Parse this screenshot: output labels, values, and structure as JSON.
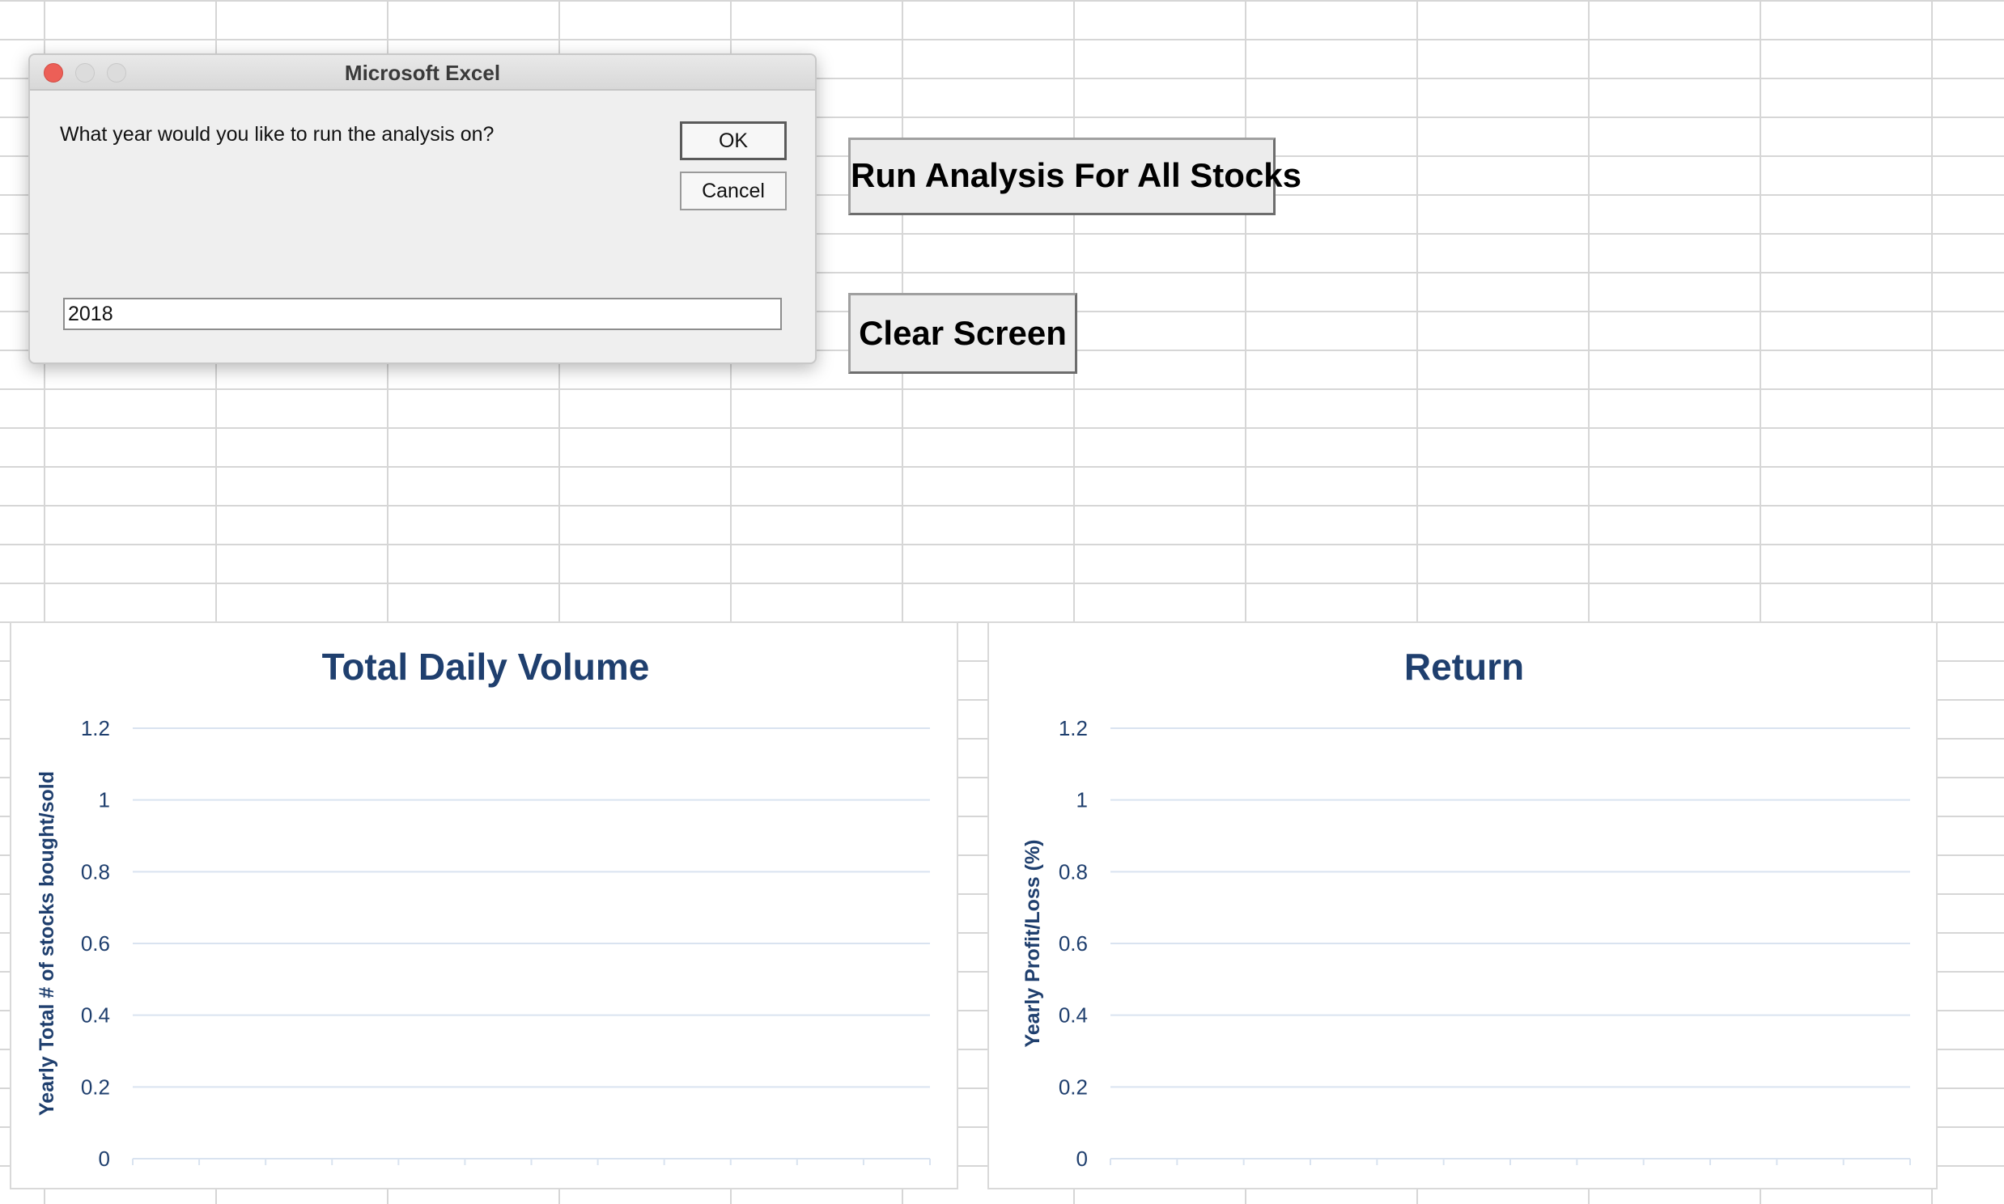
{
  "dialog": {
    "title": "Microsoft Excel",
    "prompt": "What year would you like to run the analysis on?",
    "ok_label": "OK",
    "cancel_label": "Cancel",
    "input_value": "2018"
  },
  "sheet_buttons": {
    "run_label": "Run Analysis For All Stocks",
    "clear_label": "Clear Screen"
  },
  "colors": {
    "chart_title": "#1f3f6e",
    "gridline": "#d9e3f0",
    "axis_text": "#1f3f6e"
  },
  "chart_data": [
    {
      "type": "bar",
      "title": "Total Daily Volume",
      "ylabel": "Yearly Total # of stocks bought/sold",
      "xlabel": "",
      "ylim": [
        0,
        1.2
      ],
      "yticks": [
        "1.2",
        "1",
        "0.8",
        "0.6",
        "0.4",
        "0.2",
        "0"
      ],
      "categories": [],
      "values": [],
      "grid": true
    },
    {
      "type": "bar",
      "title": "Return",
      "ylabel": "Yearly Profit/Loss (%)",
      "xlabel": "",
      "ylim": [
        0,
        1.2
      ],
      "yticks": [
        "1.2",
        "1",
        "0.8",
        "0.6",
        "0.4",
        "0.2",
        "0"
      ],
      "categories": [],
      "values": [],
      "grid": true
    }
  ]
}
